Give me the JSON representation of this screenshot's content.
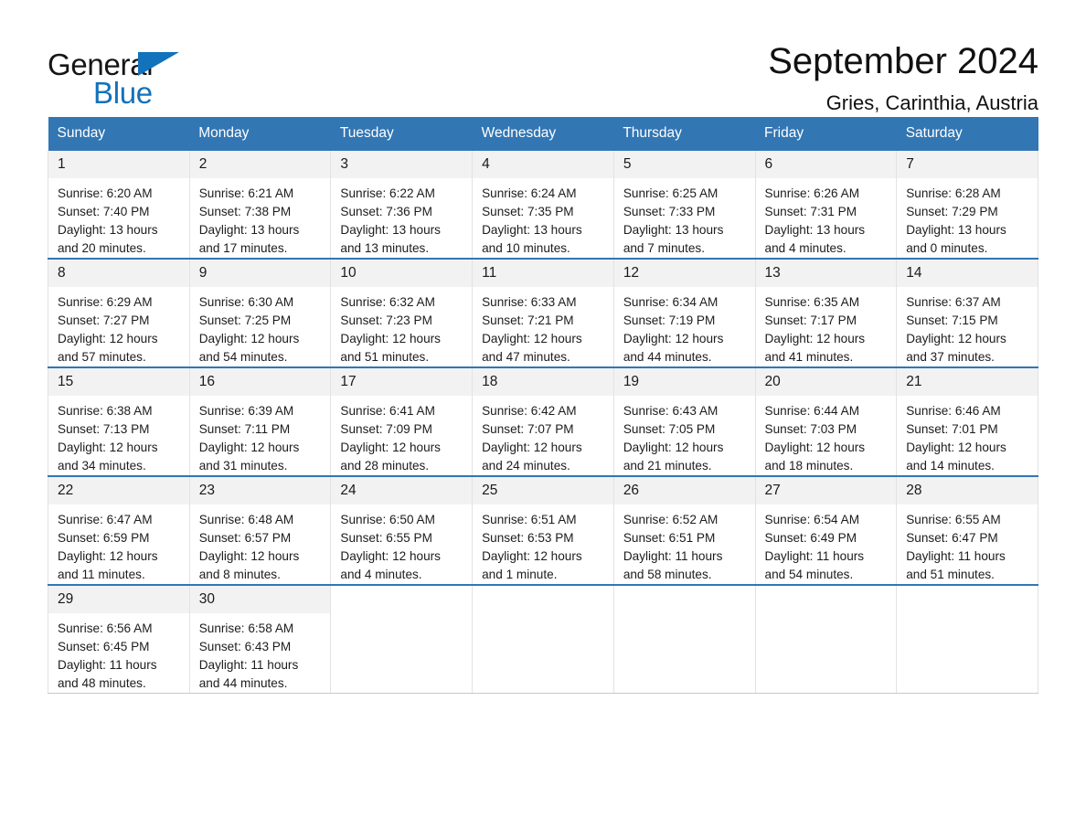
{
  "brand": {
    "name_part1": "General",
    "name_part2": "Blue",
    "accent_color": "#1272bb",
    "triangle_icon": "brand-triangle-icon"
  },
  "header": {
    "title": "September 2024",
    "location": "Gries, Carinthia, Austria"
  },
  "calendar": {
    "header_color": "#3276b3",
    "daynum_band_color": "#f2f2f2",
    "weekdays": [
      "Sunday",
      "Monday",
      "Tuesday",
      "Wednesday",
      "Thursday",
      "Friday",
      "Saturday"
    ],
    "weeks": [
      [
        {
          "day": "1",
          "sunrise": "Sunrise: 6:20 AM",
          "sunset": "Sunset: 7:40 PM",
          "daylight_line1": "Daylight: 13 hours",
          "daylight_line2": "and 20 minutes."
        },
        {
          "day": "2",
          "sunrise": "Sunrise: 6:21 AM",
          "sunset": "Sunset: 7:38 PM",
          "daylight_line1": "Daylight: 13 hours",
          "daylight_line2": "and 17 minutes."
        },
        {
          "day": "3",
          "sunrise": "Sunrise: 6:22 AM",
          "sunset": "Sunset: 7:36 PM",
          "daylight_line1": "Daylight: 13 hours",
          "daylight_line2": "and 13 minutes."
        },
        {
          "day": "4",
          "sunrise": "Sunrise: 6:24 AM",
          "sunset": "Sunset: 7:35 PM",
          "daylight_line1": "Daylight: 13 hours",
          "daylight_line2": "and 10 minutes."
        },
        {
          "day": "5",
          "sunrise": "Sunrise: 6:25 AM",
          "sunset": "Sunset: 7:33 PM",
          "daylight_line1": "Daylight: 13 hours",
          "daylight_line2": "and 7 minutes."
        },
        {
          "day": "6",
          "sunrise": "Sunrise: 6:26 AM",
          "sunset": "Sunset: 7:31 PM",
          "daylight_line1": "Daylight: 13 hours",
          "daylight_line2": "and 4 minutes."
        },
        {
          "day": "7",
          "sunrise": "Sunrise: 6:28 AM",
          "sunset": "Sunset: 7:29 PM",
          "daylight_line1": "Daylight: 13 hours",
          "daylight_line2": "and 0 minutes."
        }
      ],
      [
        {
          "day": "8",
          "sunrise": "Sunrise: 6:29 AM",
          "sunset": "Sunset: 7:27 PM",
          "daylight_line1": "Daylight: 12 hours",
          "daylight_line2": "and 57 minutes."
        },
        {
          "day": "9",
          "sunrise": "Sunrise: 6:30 AM",
          "sunset": "Sunset: 7:25 PM",
          "daylight_line1": "Daylight: 12 hours",
          "daylight_line2": "and 54 minutes."
        },
        {
          "day": "10",
          "sunrise": "Sunrise: 6:32 AM",
          "sunset": "Sunset: 7:23 PM",
          "daylight_line1": "Daylight: 12 hours",
          "daylight_line2": "and 51 minutes."
        },
        {
          "day": "11",
          "sunrise": "Sunrise: 6:33 AM",
          "sunset": "Sunset: 7:21 PM",
          "daylight_line1": "Daylight: 12 hours",
          "daylight_line2": "and 47 minutes."
        },
        {
          "day": "12",
          "sunrise": "Sunrise: 6:34 AM",
          "sunset": "Sunset: 7:19 PM",
          "daylight_line1": "Daylight: 12 hours",
          "daylight_line2": "and 44 minutes."
        },
        {
          "day": "13",
          "sunrise": "Sunrise: 6:35 AM",
          "sunset": "Sunset: 7:17 PM",
          "daylight_line1": "Daylight: 12 hours",
          "daylight_line2": "and 41 minutes."
        },
        {
          "day": "14",
          "sunrise": "Sunrise: 6:37 AM",
          "sunset": "Sunset: 7:15 PM",
          "daylight_line1": "Daylight: 12 hours",
          "daylight_line2": "and 37 minutes."
        }
      ],
      [
        {
          "day": "15",
          "sunrise": "Sunrise: 6:38 AM",
          "sunset": "Sunset: 7:13 PM",
          "daylight_line1": "Daylight: 12 hours",
          "daylight_line2": "and 34 minutes."
        },
        {
          "day": "16",
          "sunrise": "Sunrise: 6:39 AM",
          "sunset": "Sunset: 7:11 PM",
          "daylight_line1": "Daylight: 12 hours",
          "daylight_line2": "and 31 minutes."
        },
        {
          "day": "17",
          "sunrise": "Sunrise: 6:41 AM",
          "sunset": "Sunset: 7:09 PM",
          "daylight_line1": "Daylight: 12 hours",
          "daylight_line2": "and 28 minutes."
        },
        {
          "day": "18",
          "sunrise": "Sunrise: 6:42 AM",
          "sunset": "Sunset: 7:07 PM",
          "daylight_line1": "Daylight: 12 hours",
          "daylight_line2": "and 24 minutes."
        },
        {
          "day": "19",
          "sunrise": "Sunrise: 6:43 AM",
          "sunset": "Sunset: 7:05 PM",
          "daylight_line1": "Daylight: 12 hours",
          "daylight_line2": "and 21 minutes."
        },
        {
          "day": "20",
          "sunrise": "Sunrise: 6:44 AM",
          "sunset": "Sunset: 7:03 PM",
          "daylight_line1": "Daylight: 12 hours",
          "daylight_line2": "and 18 minutes."
        },
        {
          "day": "21",
          "sunrise": "Sunrise: 6:46 AM",
          "sunset": "Sunset: 7:01 PM",
          "daylight_line1": "Daylight: 12 hours",
          "daylight_line2": "and 14 minutes."
        }
      ],
      [
        {
          "day": "22",
          "sunrise": "Sunrise: 6:47 AM",
          "sunset": "Sunset: 6:59 PM",
          "daylight_line1": "Daylight: 12 hours",
          "daylight_line2": "and 11 minutes."
        },
        {
          "day": "23",
          "sunrise": "Sunrise: 6:48 AM",
          "sunset": "Sunset: 6:57 PM",
          "daylight_line1": "Daylight: 12 hours",
          "daylight_line2": "and 8 minutes."
        },
        {
          "day": "24",
          "sunrise": "Sunrise: 6:50 AM",
          "sunset": "Sunset: 6:55 PM",
          "daylight_line1": "Daylight: 12 hours",
          "daylight_line2": "and 4 minutes."
        },
        {
          "day": "25",
          "sunrise": "Sunrise: 6:51 AM",
          "sunset": "Sunset: 6:53 PM",
          "daylight_line1": "Daylight: 12 hours",
          "daylight_line2": "and 1 minute."
        },
        {
          "day": "26",
          "sunrise": "Sunrise: 6:52 AM",
          "sunset": "Sunset: 6:51 PM",
          "daylight_line1": "Daylight: 11 hours",
          "daylight_line2": "and 58 minutes."
        },
        {
          "day": "27",
          "sunrise": "Sunrise: 6:54 AM",
          "sunset": "Sunset: 6:49 PM",
          "daylight_line1": "Daylight: 11 hours",
          "daylight_line2": "and 54 minutes."
        },
        {
          "day": "28",
          "sunrise": "Sunrise: 6:55 AM",
          "sunset": "Sunset: 6:47 PM",
          "daylight_line1": "Daylight: 11 hours",
          "daylight_line2": "and 51 minutes."
        }
      ],
      [
        {
          "day": "29",
          "sunrise": "Sunrise: 6:56 AM",
          "sunset": "Sunset: 6:45 PM",
          "daylight_line1": "Daylight: 11 hours",
          "daylight_line2": "and 48 minutes."
        },
        {
          "day": "30",
          "sunrise": "Sunrise: 6:58 AM",
          "sunset": "Sunset: 6:43 PM",
          "daylight_line1": "Daylight: 11 hours",
          "daylight_line2": "and 44 minutes."
        },
        {
          "day": "",
          "sunrise": "",
          "sunset": "",
          "daylight_line1": "",
          "daylight_line2": "",
          "blank": true
        },
        {
          "day": "",
          "sunrise": "",
          "sunset": "",
          "daylight_line1": "",
          "daylight_line2": "",
          "blank": true
        },
        {
          "day": "",
          "sunrise": "",
          "sunset": "",
          "daylight_line1": "",
          "daylight_line2": "",
          "blank": true
        },
        {
          "day": "",
          "sunrise": "",
          "sunset": "",
          "daylight_line1": "",
          "daylight_line2": "",
          "blank": true
        },
        {
          "day": "",
          "sunrise": "",
          "sunset": "",
          "daylight_line1": "",
          "daylight_line2": "",
          "blank": true
        }
      ]
    ]
  }
}
